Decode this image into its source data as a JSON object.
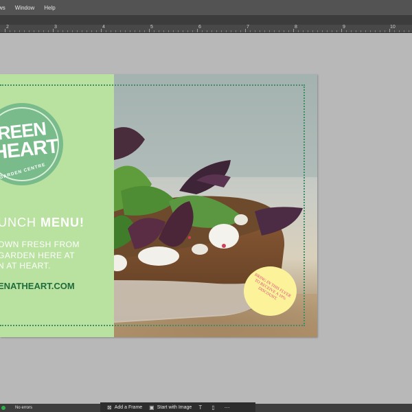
{
  "menu": {
    "items": [
      "ws",
      "Window",
      "Help"
    ]
  },
  "ruler": {
    "labels": [
      "2",
      "3",
      "4",
      "5",
      "6",
      "7",
      "8",
      "9",
      "10"
    ]
  },
  "flyer": {
    "logo": {
      "line1": "REEN",
      "line2": "HEART",
      "sub": "GARDEN CENTRE"
    },
    "headline_pre": "UNCH",
    "headline_bold": "MENU!",
    "body": [
      "OWN FRESH FROM",
      "GARDEN HERE AT",
      "N AT HEART."
    ],
    "url": "ENATHEART.COM",
    "badge": "BRING IN THIS FLYER TO RECEIVE A 10% DISCOUNT."
  },
  "colors": {
    "panel": "#b9e2a0",
    "logo": "#79bb8b",
    "url": "#1f6b3c",
    "badge_bg": "#fbf29a",
    "badge_text": "#e14a7a",
    "border": "#3f8e63"
  },
  "status": {
    "message": "No errors"
  },
  "taskbar": {
    "add_frame": "Add a Frame",
    "start_image": "Start with Image"
  }
}
